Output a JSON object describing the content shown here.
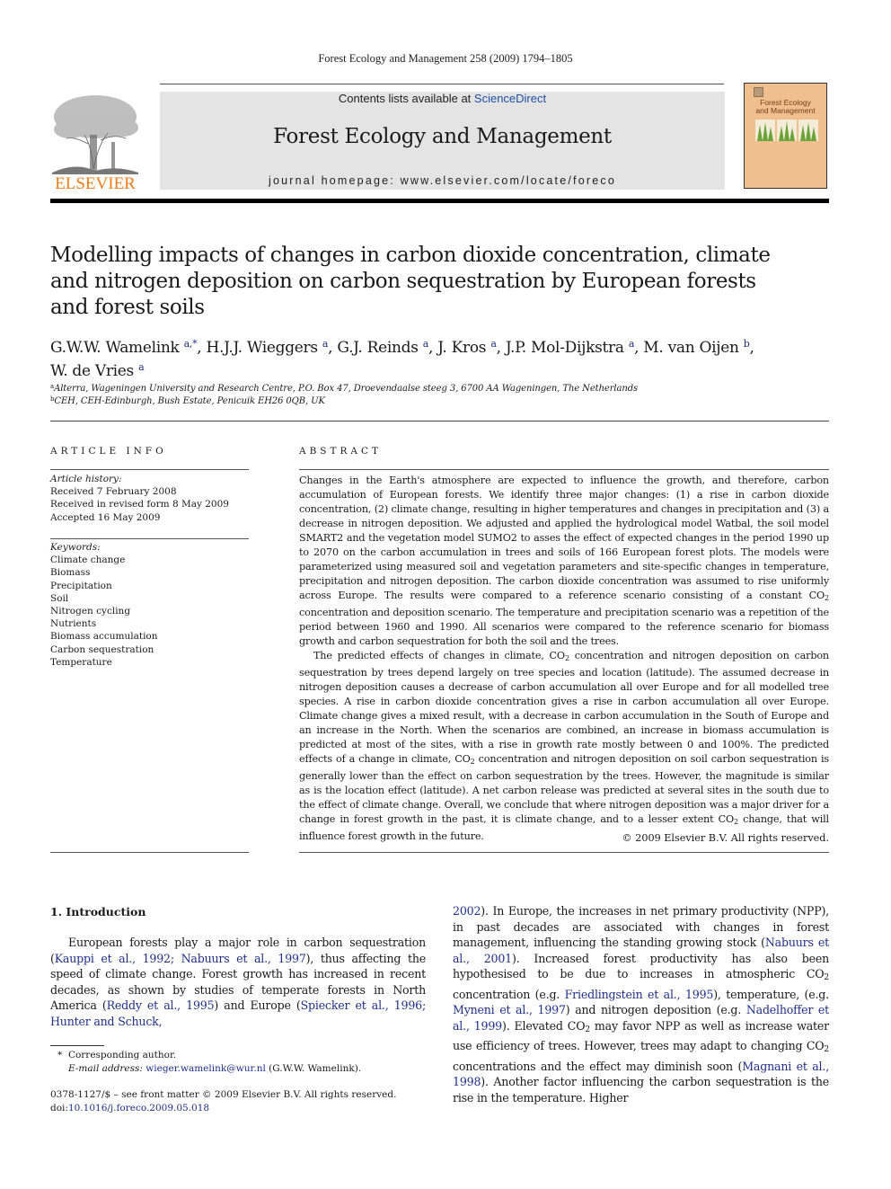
{
  "journal": {
    "running_head": "Forest Ecology and Management 258 (2009) 1794–1805",
    "contents_prefix": "Contents lists available at ",
    "contents_link": "ScienceDirect",
    "title": "Forest Ecology and Management",
    "homepage": "journal homepage: www.elsevier.com/locate/foreco",
    "publisher_logo_text": "ELSEVIER",
    "cover_title_line1": "Forest Ecology",
    "cover_title_line2": "and Management",
    "brand_color": "#f07c1a",
    "link_color": "#1f2f8a"
  },
  "article": {
    "title_lines": [
      "Modelling impacts of changes in carbon dioxide concentration, climate",
      "and nitrogen deposition on carbon sequestration by European forests",
      "and forest soils"
    ],
    "authors": [
      {
        "name": "G.W.W. Wamelink",
        "aff": "a,*",
        "sep": ", "
      },
      {
        "name": "H.J.J. Wieggers",
        "aff": "a",
        "sep": ", "
      },
      {
        "name": "G.J. Reinds",
        "aff": "a",
        "sep": ", "
      },
      {
        "name": "J. Kros",
        "aff": "a",
        "sep": ", "
      },
      {
        "name": "J.P. Mol-Dijkstra",
        "aff": "a",
        "sep": ", "
      },
      {
        "name": "M. van Oijen",
        "aff": "b",
        "sep": ","
      },
      {
        "name": "W. de Vries",
        "aff": "a",
        "sep": ""
      }
    ],
    "affiliations": [
      {
        "key": "a",
        "text": "Alterra, Wageningen University and Research Centre, P.O. Box 47, Droevendaalse steeg 3, 6700 AA Wageningen, The Netherlands"
      },
      {
        "key": "b",
        "text": "CEH, CEH-Edinburgh, Bush Estate, Penicuik EH26 0QB, UK"
      }
    ]
  },
  "article_info": {
    "heading": "ARTICLE INFO",
    "history_label": "Article history:",
    "history": [
      "Received 7 February 2008",
      "Received in revised form 8 May 2009",
      "Accepted 16 May 2009"
    ],
    "keywords_label": "Keywords:",
    "keywords": [
      "Climate change",
      "Biomass",
      "Precipitation",
      "Soil",
      "Nitrogen cycling",
      "Nutrients",
      "Biomass accumulation",
      "Carbon sequestration",
      "Temperature"
    ]
  },
  "abstract": {
    "heading": "ABSTRACT",
    "p1_parts": [
      "Changes in the Earth's atmosphere are expected to influence the growth, and therefore, carbon accumulation of European forests. We identify three major changes: (1) a rise in carbon dioxide concentration, (2) climate change, resulting in higher temperatures and changes in precipitation and (3) a decrease in nitrogen deposition. We adjusted and applied the hydrological model Watbal, the soil model SMART2 and the vegetation model SUMO2 to asses the effect of expected changes in the period 1990 up to 2070 on the carbon accumulation in trees and soils of 166 European forest plots. The models were parameterized using measured soil and vegetation parameters and site-specific changes in temperature, precipitation and nitrogen deposition. The carbon dioxide concentration was assumed to rise uniformly across Europe. The results were compared to a reference scenario consisting of a constant CO",
      " concentration and deposition scenario. The temperature and precipitation scenario was a repetition of the period between 1960 and 1990. All scenarios were compared to the reference scenario for biomass growth and carbon sequestration for both the soil and the trees."
    ],
    "p2_parts": [
      "The predicted effects of changes in climate, CO",
      " concentration and nitrogen deposition on carbon sequestration by trees depend largely on tree species and location (latitude). The assumed decrease in nitrogen deposition causes a decrease of carbon accumulation all over Europe and for all modelled tree species. A rise in carbon dioxide concentration gives a rise in carbon accumulation all over Europe. Climate change gives a mixed result, with a decrease in carbon accumulation in the South of Europe and an increase in the North. When the scenarios are combined, an increase in biomass accumulation is predicted at most of the sites, with a rise in growth rate mostly between 0 and 100%. The predicted effects of a change in climate, CO",
      " concentration and nitrogen deposition on soil carbon sequestration is generally lower than the effect on carbon sequestration by the trees. However, the magnitude is similar as is the location effect (latitude). A net carbon release was predicted at several sites in the south due to the effect of climate change. Overall, we conclude that where nitrogen deposition was a major driver for a change in forest growth in the past, it is climate change, and to a lesser extent CO",
      " change, that will influence forest growth in the future."
    ],
    "subscript": "2",
    "copyright": "© 2009 Elsevier B.V. All rights reserved."
  },
  "introduction": {
    "heading": "1.  Introduction",
    "left_col": [
      {
        "t": "European forests play a major role in carbon sequestration ("
      },
      {
        "t": "Kauppi et al., 1992; Nabuurs et al., 1997",
        "link": true
      },
      {
        "t": "), thus affecting the speed of climate change. Forest growth has increased in recent decades, as shown by studies of temperate forests in North America ("
      },
      {
        "t": "Reddy et al., 1995",
        "link": true
      },
      {
        "t": ") and Europe ("
      },
      {
        "t": "Spiecker et al., 1996; Hunter and Schuck,",
        "link": true
      }
    ],
    "right_col": [
      {
        "t": "2002",
        "link": true
      },
      {
        "t": "). In Europe, the increases in net primary productivity (NPP), in past decades are associated with changes in forest management, influencing the standing growing stock ("
      },
      {
        "t": "Nabuurs et al., 2001",
        "link": true
      },
      {
        "t": "). Increased forest productivity has also been hypothesised to be due to increases in atmospheric CO"
      },
      {
        "t": "2",
        "sub": true
      },
      {
        "t": " concentration (e.g. "
      },
      {
        "t": "Friedlingstein et al., 1995",
        "link": true
      },
      {
        "t": "), temperature, (e.g. "
      },
      {
        "t": "Myneni et al., 1997",
        "link": true
      },
      {
        "t": ") and nitrogen deposition (e.g. "
      },
      {
        "t": "Nadelhoffer et al., 1999",
        "link": true
      },
      {
        "t": "). Elevated CO"
      },
      {
        "t": "2",
        "sub": true
      },
      {
        "t": " may favor NPP as well as increase water use efficiency of trees. However, trees may adapt to changing CO"
      },
      {
        "t": "2",
        "sub": true
      },
      {
        "t": " concentrations and the effect may diminish soon ("
      },
      {
        "t": "Magnani et al., 1998",
        "link": true
      },
      {
        "t": "). Another factor influencing the carbon sequestration is the rise in the temperature. Higher"
      }
    ]
  },
  "footnotes": {
    "star": "*",
    "corresponding": "Corresponding author.",
    "email_label": "E-mail address:",
    "email": "wieger.wamelink@wur.nl",
    "email_suffix": " (G.W.W. Wamelink).",
    "front_matter": "0378-1127/$ – see front matter © 2009 Elsevier B.V. All rights reserved.",
    "doi_prefix": "doi:",
    "doi": "10.1016/j.foreco.2009.05.018"
  }
}
